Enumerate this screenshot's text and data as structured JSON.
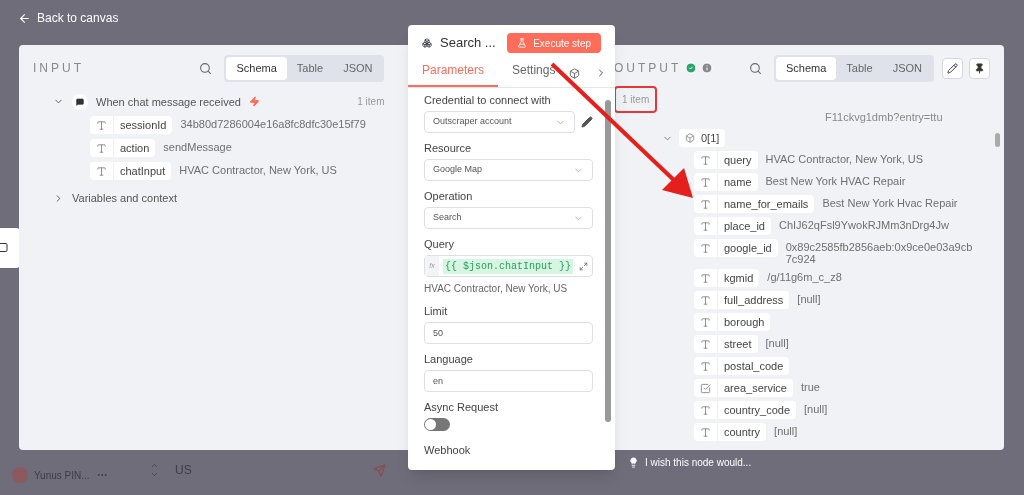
{
  "top_bar": {
    "back_link": "Back to canvas"
  },
  "background": {
    "user_name": "Yunus PIN...",
    "chat_text": "US"
  },
  "input": {
    "title": "INPUT",
    "view_tabs": [
      {
        "label": "Schema",
        "selected": true
      },
      {
        "label": "Table",
        "selected": false
      },
      {
        "label": "JSON",
        "selected": false
      }
    ],
    "node": {
      "name": "When chat message received",
      "count": "1 item",
      "expanded": true,
      "fields": [
        {
          "kind": "string",
          "key": "sessionId",
          "value": "34b80d7286004e16a8fc8dfc30e15f79"
        },
        {
          "kind": "string",
          "key": "action",
          "value": "sendMessage"
        },
        {
          "kind": "string",
          "key": "chatInput",
          "value": "HVAC Contractor, New York, US"
        }
      ]
    },
    "section": {
      "label": "Variables and context",
      "expanded": false
    }
  },
  "node_panel": {
    "title": "Search ...",
    "execute_button": "Execute step",
    "tabs": [
      {
        "label": "Parameters",
        "selected": true
      },
      {
        "label": "Settings",
        "selected": false
      }
    ],
    "credential": {
      "label": "Credential to connect with",
      "value": "Outscraper account"
    },
    "resource": {
      "label": "Resource",
      "value": "Google Map"
    },
    "operation": {
      "label": "Operation",
      "value": "Search"
    },
    "query": {
      "label": "Query",
      "prefix": "fx",
      "expression": "{{ $json.chatInput }}",
      "result": "HVAC Contractor, New York, US"
    },
    "limit": {
      "label": "Limit",
      "value": "50"
    },
    "language": {
      "label": "Language",
      "value": "en"
    },
    "async_request": {
      "label": "Async Request",
      "on": false
    },
    "webhook": {
      "label": "Webhook"
    }
  },
  "output": {
    "title": "OUTPUT",
    "view_tabs": [
      {
        "label": "Schema",
        "selected": true
      },
      {
        "label": "Table",
        "selected": false
      },
      {
        "label": "JSON",
        "selected": false
      }
    ],
    "count": "1 item",
    "overflow_text": "F11ckvg1dmb?entry=ttu",
    "item": {
      "label": "0[1]",
      "expanded": true,
      "fields": [
        {
          "kind": "string",
          "key": "query",
          "value": "HVAC Contractor, New York, US"
        },
        {
          "kind": "string",
          "key": "name",
          "value": "Best New York HVAC Repair"
        },
        {
          "kind": "string",
          "key": "name_for_emails",
          "value": "Best New York Hvac Repair"
        },
        {
          "kind": "string",
          "key": "place_id",
          "value": "ChIJ62qFsl9YwokRJMm3nDrg4Jw"
        },
        {
          "kind": "string",
          "key": "google_id",
          "value": "0x89c2585fb2856aeb:0x9ce0e03a9cb7c924"
        },
        {
          "kind": "string",
          "key": "kgmid",
          "value": "/g/11g6m_c_z8"
        },
        {
          "kind": "string",
          "key": "full_address",
          "value": "[null]"
        },
        {
          "kind": "string",
          "key": "borough"
        },
        {
          "kind": "string",
          "key": "street",
          "value": "[null]"
        },
        {
          "kind": "string",
          "key": "postal_code"
        },
        {
          "kind": "boolean",
          "key": "area_service",
          "value": "true"
        },
        {
          "kind": "string",
          "key": "country_code",
          "value": "[null]"
        },
        {
          "kind": "string",
          "key": "country",
          "value": "[null]"
        }
      ]
    }
  },
  "feedback": {
    "text": "I wish this node would..."
  }
}
